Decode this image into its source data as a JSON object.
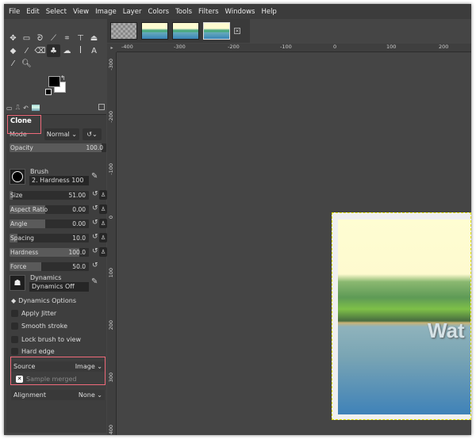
{
  "menu": [
    "File",
    "Edit",
    "Select",
    "View",
    "Image",
    "Layer",
    "Colors",
    "Tools",
    "Filters",
    "Windows",
    "Help"
  ],
  "tool_options": {
    "title": "Clone",
    "mode_label": "Mode",
    "mode_value": "Normal",
    "opacity": {
      "label": "Opacity",
      "value": "100.0",
      "fraction": 1.0
    },
    "brush_label": "Brush",
    "brush_name": "2. Hardness 100",
    "size": {
      "label": "Size",
      "value": "51.00",
      "fraction": 0.05
    },
    "aspect_ratio": {
      "label": "Aspect Ratio",
      "value": "0.00",
      "fraction": 0.5
    },
    "angle": {
      "label": "Angle",
      "value": "0.00",
      "fraction": 0.5
    },
    "spacing": {
      "label": "Spacing",
      "value": "10.0",
      "fraction": 0.1
    },
    "hardness": {
      "label": "Hardness",
      "value": "100.0",
      "fraction": 1.0
    },
    "force": {
      "label": "Force",
      "value": "50.0",
      "fraction": 0.5
    },
    "dynamics_label": "Dynamics",
    "dynamics_value": "Dynamics Off",
    "dynamics_options": "Dynamics Options",
    "apply_jitter": "Apply Jitter",
    "smooth_stroke": "Smooth stroke",
    "lock_brush": "Lock brush to view",
    "hard_edge": "Hard edge",
    "source_label": "Source",
    "source_value": "Image",
    "sample_merged": "Sample merged",
    "alignment_label": "Alignment",
    "alignment_value": "None"
  },
  "rulers": {
    "horizontal": [
      "-400",
      "-300",
      "-200",
      "-100",
      "0",
      "100",
      "200"
    ],
    "vertical": [
      "-300",
      "-200",
      "-100",
      "0",
      "100",
      "200",
      "300",
      "400"
    ]
  },
  "canvas": {
    "overlay_text": "Wat"
  }
}
